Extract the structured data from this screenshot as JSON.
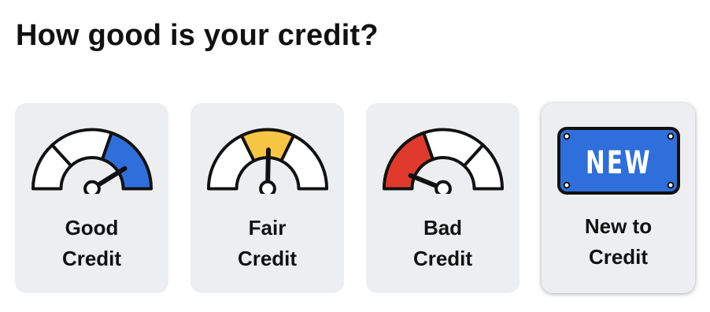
{
  "heading": "How good is your credit?",
  "colors": {
    "good": "#2f6fdc",
    "fair": "#f6c544",
    "bad": "#e03a2c",
    "badge": "#2f6fdc",
    "card_bg": "#eceef0"
  },
  "options": [
    {
      "line1": "Good",
      "line2": "Credit",
      "icon": "gauge-high-icon",
      "highlight": "right"
    },
    {
      "line1": "Fair",
      "line2": "Credit",
      "icon": "gauge-mid-icon",
      "highlight": "middle"
    },
    {
      "line1": "Bad",
      "line2": "Credit",
      "icon": "gauge-low-icon",
      "highlight": "left"
    },
    {
      "line1": "New to",
      "line2": "Credit",
      "icon": "new-badge-icon",
      "badge_text": "NEW",
      "selected": true
    }
  ]
}
